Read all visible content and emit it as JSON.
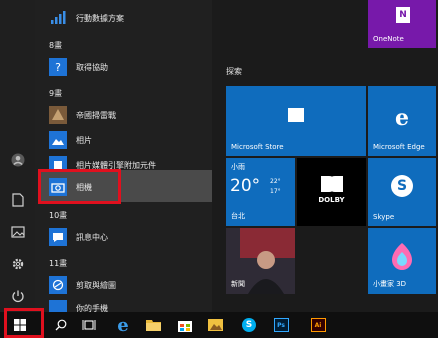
{
  "rail": {
    "icons": [
      "user-icon",
      "document-icon",
      "pictures-icon",
      "settings-icon",
      "power-icon"
    ]
  },
  "apps": [
    {
      "label": "行動數據方案",
      "icon": "signal",
      "color": "#1e73d6"
    },
    {
      "section": "8畫"
    },
    {
      "label": "取得協助",
      "icon": "help",
      "color": "#1e73d6"
    },
    {
      "section": "9畫"
    },
    {
      "label": "帝國掃雷戰",
      "icon": "game",
      "color": "#6a3e2a"
    },
    {
      "label": "相片",
      "icon": "photo",
      "color": "#1e73d6"
    },
    {
      "label": "相片媒體引擎附加元件",
      "icon": "photo-engine",
      "color": "#1e73d6"
    },
    {
      "label": "相機",
      "icon": "camera",
      "color": "#1e73d6"
    },
    {
      "section": "10畫"
    },
    {
      "label": "訊息中心",
      "icon": "message",
      "color": "#1e73d6"
    },
    {
      "section": "11畫"
    },
    {
      "label": "剪取與繪圖",
      "icon": "snip",
      "color": "#1e73d6"
    },
    {
      "label": "你的手機",
      "icon": "phone",
      "color": "#1e73d6"
    }
  ],
  "tiles": {
    "group_label": "探索",
    "onenote": "OneNote",
    "store": "Microsoft Store",
    "edge": "Microsoft Edge",
    "weather": {
      "condition": "小雨",
      "temp": "20°",
      "high": "22°",
      "low": "17°",
      "city": "台北"
    },
    "dolby": "DOLBY",
    "skype": "Skype",
    "news": "新聞",
    "paint3d": "小畫家 3D"
  },
  "taskbar": {
    "items": [
      "start",
      "search",
      "taskview",
      "edge",
      "explorer",
      "store",
      "photos",
      "skype",
      "photoshop",
      "illustrator"
    ]
  },
  "colors": {
    "accent": "#0078d7",
    "highlight": "#e0101e"
  }
}
